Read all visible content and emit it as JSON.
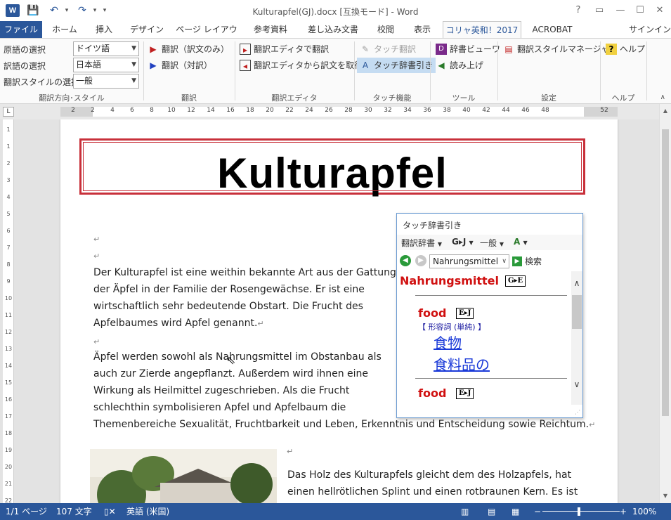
{
  "titlebar": {
    "title": "Kulturapfel(GJ).docx [互換モード] - Word",
    "help": "?",
    "minimize": "—",
    "restore": "☐",
    "close": "✕",
    "qat_save": "💾",
    "qat_undo": "↶",
    "qat_redo": "↷",
    "qat_more": "▾",
    "app_logo": "W"
  },
  "tabs": [
    {
      "label": "ファイル"
    },
    {
      "label": "ホーム"
    },
    {
      "label": "挿入"
    },
    {
      "label": "デザイン"
    },
    {
      "label": "ページ レイアウト"
    },
    {
      "label": "参考資料"
    },
    {
      "label": "差し込み文書"
    },
    {
      "label": "校閲"
    },
    {
      "label": "表示"
    },
    {
      "label": "コリャ英和！2017"
    },
    {
      "label": "ACROBAT"
    }
  ],
  "signin": "サインイン",
  "ribbon": {
    "dir": {
      "src_label": "原語の選択",
      "src_value": "ドイツ語",
      "tgt_label": "訳語の選択",
      "tgt_value": "日本語",
      "style_label": "翻訳スタイルの選択",
      "style_value": "一般",
      "group": "翻訳方向･スタイル"
    },
    "translate": {
      "btn1": "翻訳（訳文のみ）",
      "btn2": "翻訳（対訳）",
      "group": "翻訳"
    },
    "editor": {
      "btn1": "翻訳エディタで翻訳",
      "btn2": "翻訳エディタから訳文を取得",
      "group": "翻訳エディタ"
    },
    "touch": {
      "btn1": "タッチ翻訳",
      "btn2": "タッチ辞書引き",
      "group": "タッチ機能"
    },
    "tools": {
      "btn1": "辞書ビューワ",
      "btn2": "読み上げ",
      "group": "ツール"
    },
    "settings": {
      "btn1": "翻訳スタイルマネージャ",
      "group": "設定"
    },
    "help": {
      "btn1": "ヘルプ",
      "group": "ヘルプ"
    },
    "collapse": "∧"
  },
  "ruler": {
    "numbers": [
      "2",
      "2",
      "4",
      "6",
      "8",
      "10",
      "12",
      "14",
      "16",
      "18",
      "20",
      "22",
      "24",
      "26",
      "28",
      "30",
      "32",
      "34",
      "36",
      "38",
      "40",
      "42",
      "44",
      "46",
      "48",
      "52"
    ],
    "corner": "L"
  },
  "vruler": {
    "numbers": [
      "1",
      "1",
      "2",
      "3",
      "4",
      "5",
      "6",
      "7",
      "8",
      "9",
      "10",
      "11",
      "12",
      "13",
      "14",
      "15",
      "16",
      "17",
      "18",
      "19",
      "20",
      "21",
      "22"
    ]
  },
  "document": {
    "title": "Kulturapfel",
    "paragraph_mark": "↵",
    "lines": [
      " Der Kulturapfel ist eine weithin bekannte Art aus der Gattung",
      "der Äpfel in der Familie der Rosengewächse. Er ist eine",
      "wirtschaftlich sehr bedeutende Obstart. Die Frucht des",
      "Apfelbaumes wird Apfel genannt.",
      "Äpfel werden sowohl als Nahrungsmittel im Obstanbau als",
      "auch zur Zierde angepflanzt. Außerdem wird ihnen eine",
      "Wirkung als Heilmittel zugeschrieben. Als die Frucht",
      "schlechthin symbolisieren Apfel und Apfelbaum die",
      "Themenbereiche Sexualität, Fruchtbarkeit und Leben, Erkenntnis und Entscheidung sowie Reichtum.",
      "Das Holz des Kulturapfels gleicht dem des Holzapfels, hat",
      "einen hellrötlichen Splint und einen rotbraunen Kern. Es ist"
    ]
  },
  "popup": {
    "title": "タッチ辞書引き",
    "toolbar": {
      "dict": "翻訳辞書",
      "dir": "G▸J",
      "style": "一般",
      "extra": "A"
    },
    "search_value": "Nahrungsmittel",
    "search_btn": "検索",
    "headword": "Nahrungsmittel",
    "headword_badge": "G▸E",
    "entries": [
      {
        "word": "food",
        "badge": "E▸J",
        "pos": "【 形容詞 (単純) 】",
        "trans": [
          "食物",
          "食料品の"
        ]
      },
      {
        "word": "food",
        "badge": "E▸J"
      }
    ]
  },
  "statusbar": {
    "page": "1/1 ページ",
    "words": "107 文字",
    "lang": "英語 (米国)",
    "zoom_minus": "−",
    "zoom_plus": "+",
    "zoom": "100%"
  }
}
